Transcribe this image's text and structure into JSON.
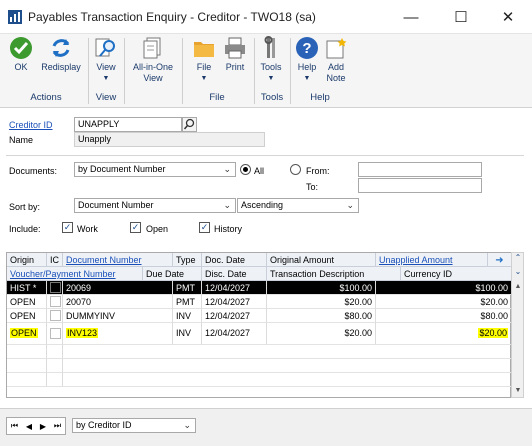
{
  "window": {
    "title": "Payables Transaction Enquiry - Creditor  -  TWO18 (sa)"
  },
  "ribbon": {
    "ok": "OK",
    "redisplay": "Redisplay",
    "actions_group": "Actions",
    "view": "View",
    "view_group": "View",
    "all_in_one_line1": "All-in-One",
    "all_in_one_line2": "View",
    "file": "File",
    "print": "Print",
    "file_group": "File",
    "tools": "Tools",
    "tools_group": "Tools",
    "help": "Help",
    "add_note_line1": "Add",
    "add_note_line2": "Note",
    "help_group": "Help"
  },
  "form": {
    "creditor_id_label": "Creditor ID",
    "creditor_id_value": "UNAPPLY",
    "name_label": "Name",
    "name_value": "Unapply",
    "documents_label": "Documents:",
    "documents_value": "by Document Number",
    "all_label": "All",
    "from_label": "From:",
    "to_label": "To:",
    "sortby_label": "Sort by:",
    "sortby_value": "Document Number",
    "order_value": "Ascending",
    "include_label": "Include:",
    "work_label": "Work",
    "open_label": "Open",
    "history_label": "History"
  },
  "grid": {
    "headers_row1": [
      "Origin",
      "IC",
      "Document Number",
      "Type",
      "Doc. Date",
      "Original Amount",
      "Unapplied Amount"
    ],
    "headers_row2": [
      "Voucher/Payment Number",
      "Due Date",
      "Disc. Date",
      "Transaction Description",
      "Currency ID"
    ],
    "rows": [
      {
        "origin": "HIST *",
        "doc": "20069",
        "type": "PMT",
        "date": "12/04/2027",
        "orig": "$100.00",
        "unapplied": "$100.00"
      },
      {
        "origin": "OPEN",
        "doc": "20070",
        "type": "PMT",
        "date": "12/04/2027",
        "orig": "$20.00",
        "unapplied": "$20.00"
      },
      {
        "origin": "OPEN",
        "doc": "DUMMYINV",
        "type": "INV",
        "date": "12/04/2027",
        "orig": "$80.00",
        "unapplied": "$80.00"
      },
      {
        "origin": "OPEN",
        "doc": "INV123",
        "type": "INV",
        "date": "12/04/2027",
        "orig": "$20.00",
        "unapplied": "$20.00"
      }
    ]
  },
  "footer": {
    "browse_value": "by Creditor ID"
  },
  "colors": {
    "highlight": "#ffff00",
    "selected_row": "#000000",
    "link": "#1a4fb8"
  }
}
